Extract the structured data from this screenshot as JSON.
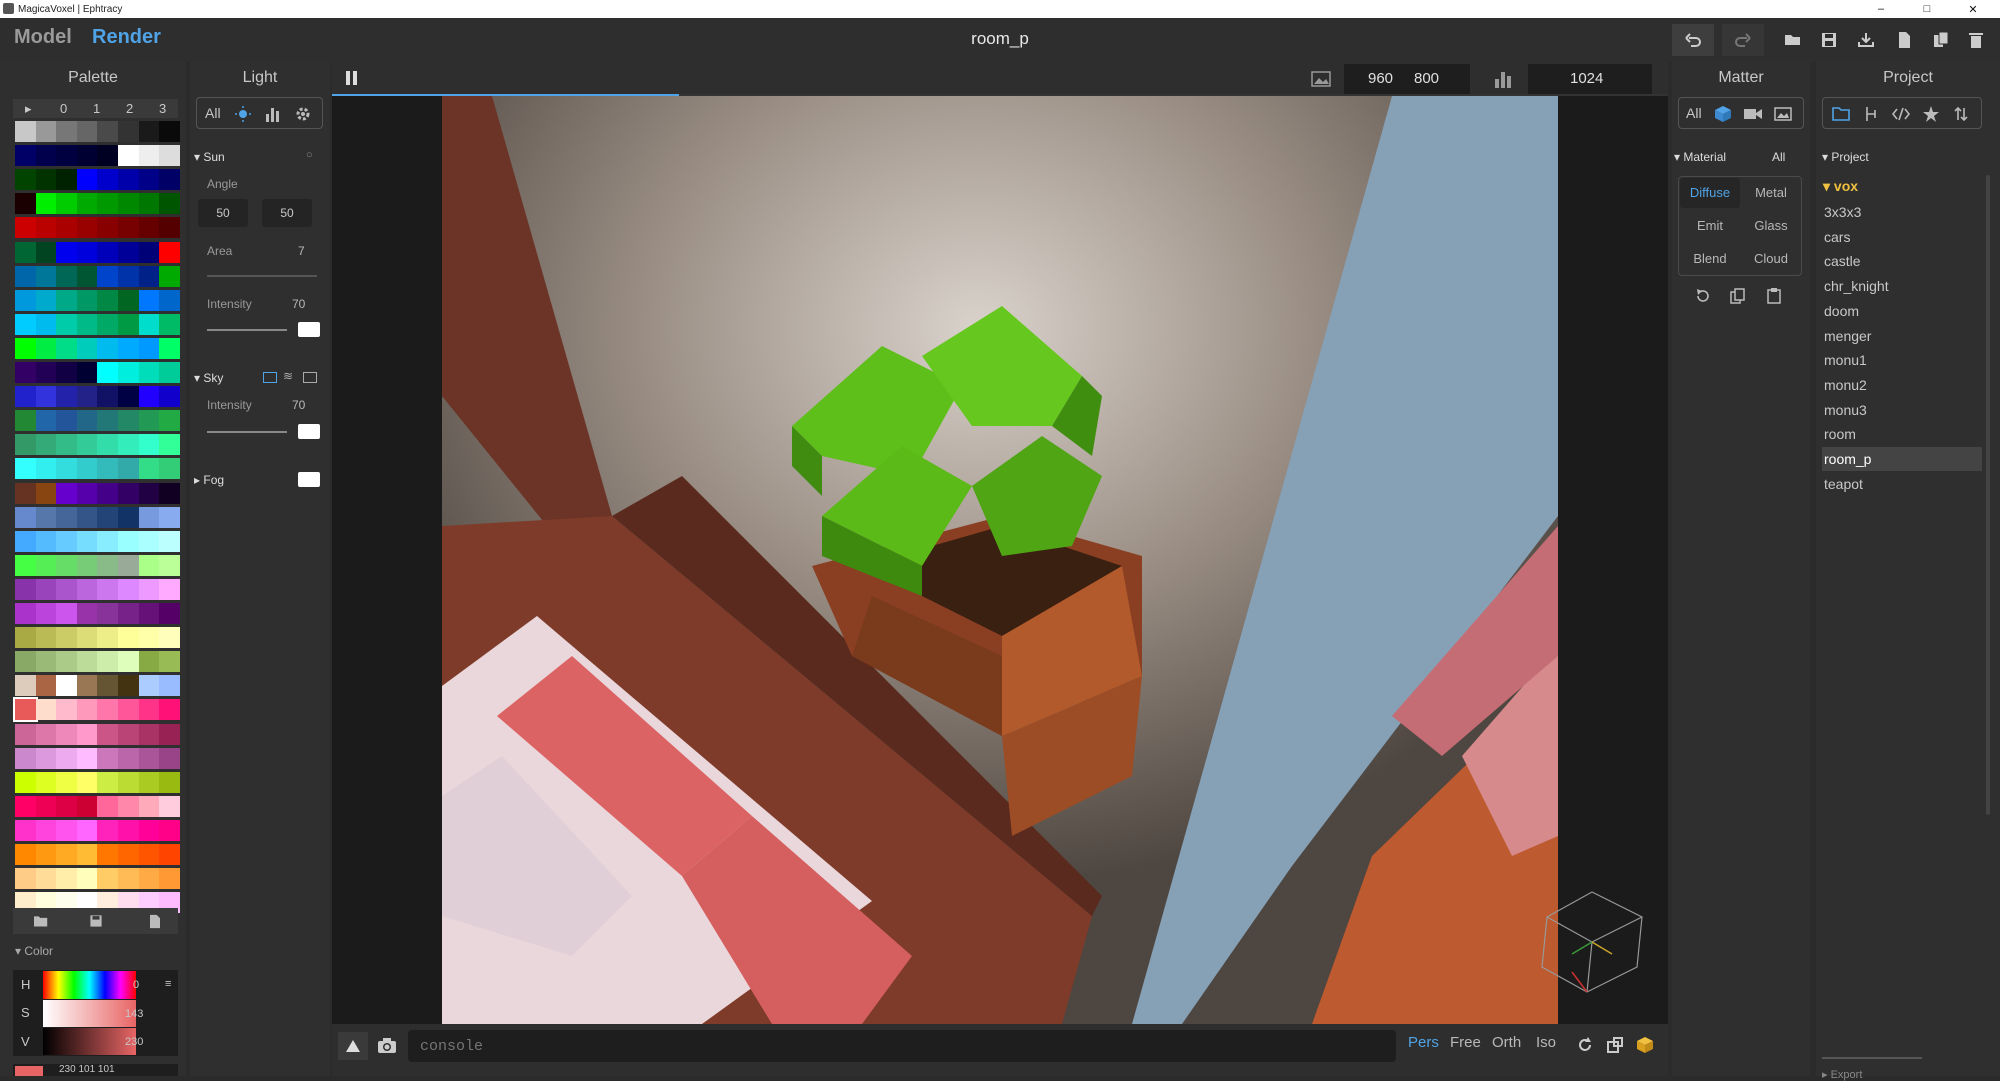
{
  "window": {
    "title": "MagicaVoxel | Ephtracy",
    "minimize": "–",
    "maximize": "□",
    "close": "✕"
  },
  "topbar": {
    "mode_model": "Model",
    "mode_render": "Render",
    "file_title": "room_p",
    "accent_color": "#4fa3e6"
  },
  "palette": {
    "header": "Palette",
    "tabs": [
      "▸",
      "0",
      "1",
      "2",
      "3"
    ],
    "selected_color": "#e85a5a",
    "color_section": "Color",
    "h_label": "H",
    "s_label": "S",
    "v_label": "V",
    "h_value": "0",
    "s_value": "143",
    "v_value": "230",
    "rgb_value": "230 101 101"
  },
  "light": {
    "header": "Light",
    "filter_all": "All",
    "sun": {
      "label": "Sun",
      "angle_label": "Angle",
      "angle_1": "50",
      "angle_2": "50",
      "area_label": "Area",
      "area_value": "7",
      "intensity_label": "Intensity",
      "intensity_value": "70"
    },
    "sky": {
      "label": "Sky",
      "intensity_label": "Intensity",
      "intensity_value": "70"
    },
    "fog": {
      "label": "Fog"
    }
  },
  "viewport": {
    "render_width": "960",
    "render_height": "800",
    "samples": "1024",
    "progress": 0.26,
    "console_placeholder": "console",
    "view_modes": [
      "Pers",
      "Free",
      "Orth",
      "Iso"
    ],
    "active_view_mode": "Pers"
  },
  "matter": {
    "header": "Matter",
    "filter_all": "All",
    "material_label": "Material",
    "material_all": "All",
    "materials": [
      "Diffuse",
      "Metal",
      "Emit",
      "Glass",
      "Blend",
      "Cloud"
    ],
    "active_material": "Diffuse"
  },
  "project": {
    "header": "Project",
    "section_label": "Project",
    "folder": "vox",
    "items": [
      "3x3x3",
      "cars",
      "castle",
      "chr_knight",
      "doom",
      "menger",
      "monu1",
      "monu2",
      "monu3",
      "room",
      "room_p",
      "teapot"
    ],
    "selected_item": "room_p",
    "export_label": "Export"
  }
}
